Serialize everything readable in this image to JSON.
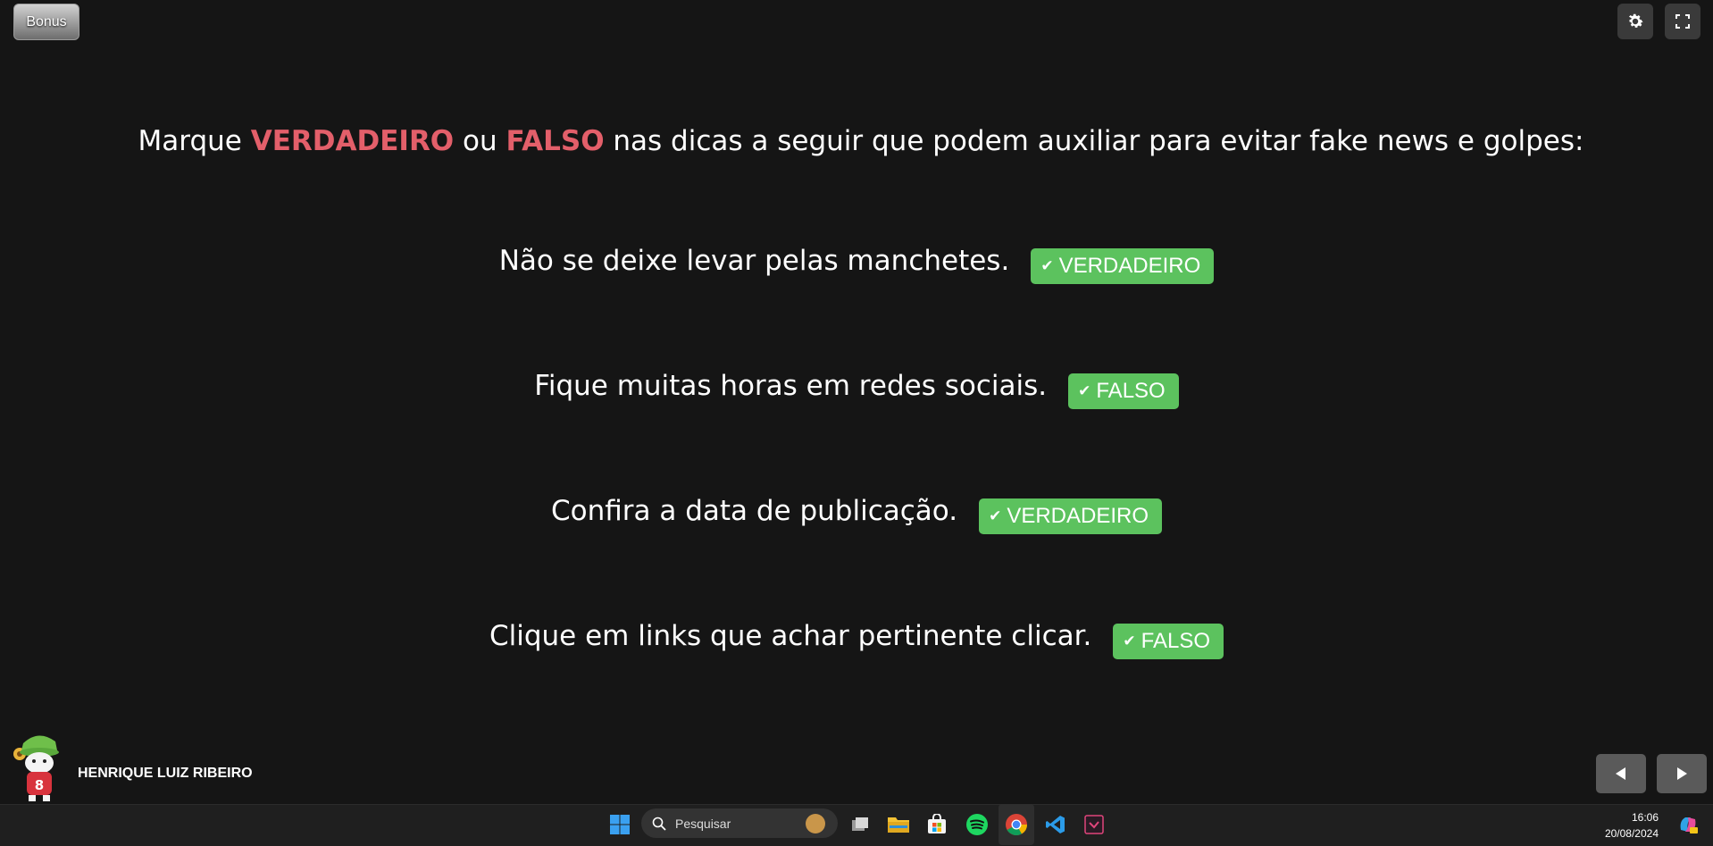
{
  "top_bar": {
    "bonus_label": "Bonus",
    "settings_icon": "gear-icon",
    "fullscreen_icon": "fullscreen-icon"
  },
  "question": {
    "prefix": "Marque ",
    "option_true": "VERDADEIRO",
    "middle": " ou ",
    "option_false": "FALSO",
    "suffix": " nas dicas a seguir que podem auxiliar para evitar fake news e golpes:"
  },
  "items": [
    {
      "statement": "Não se deixe levar pelas manchetes.",
      "answer": "VERDADEIRO"
    },
    {
      "statement": "Fique muitas horas em redes sociais.",
      "answer": "FALSO"
    },
    {
      "statement": "Confira a data de publicação.",
      "answer": "VERDADEIRO"
    },
    {
      "statement": "Clique em links que achar pertinente clicar.",
      "answer": "FALSO"
    }
  ],
  "footer": {
    "author": "HENRIQUE LUIZ RIBEIRO"
  },
  "taskbar": {
    "search_placeholder": "Pesquisar",
    "time": "16:06",
    "date": "20/08/2024",
    "apps": [
      "windows-start-icon",
      "task-view-icon",
      "file-explorer-icon",
      "store-icon",
      "spotify-icon",
      "chrome-icon",
      "vscode-icon",
      "app-icon",
      "copilot-icon"
    ]
  },
  "colors": {
    "background": "#151515",
    "highlight": "#e35f6a",
    "answer_badge": "#5cc25e"
  }
}
